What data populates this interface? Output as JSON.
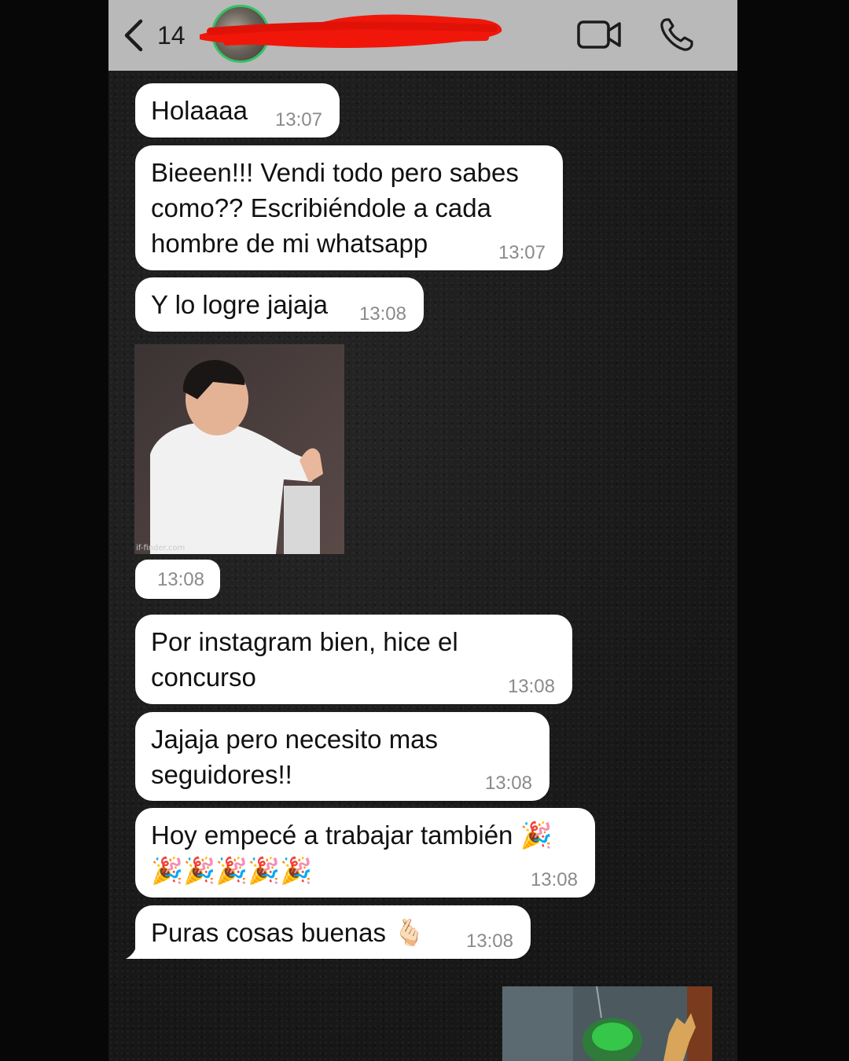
{
  "header": {
    "back_count": "14",
    "contact_name_redacted": true
  },
  "messages": [
    {
      "text": "Holaaaa",
      "time": "13:07"
    },
    {
      "text": "Bieeen!!! Vendi todo pero sabes como?? Escribiéndole a cada hombre de mi whatsapp",
      "time": "13:07"
    },
    {
      "text": "Y lo logre jajaja",
      "time": "13:08"
    },
    {
      "media": "gif",
      "caption": "if-finder.com",
      "time": "13:08"
    },
    {
      "text": "Por instagram bien, hice el concurso",
      "time": "13:08"
    },
    {
      "text": "Jajaja pero necesito mas seguidores!!",
      "time": "13:08"
    },
    {
      "text": "Hoy empecé a trabajar también 🎉🎉🎉🎉🎉🎉",
      "time": "13:08"
    },
    {
      "text": "Puras cosas buenas 🫰🏻",
      "time": "13:08"
    }
  ],
  "colors": {
    "header_bg": "#b9b9b9",
    "bubble_bg": "#ffffff",
    "timestamp": "#8a8a8a",
    "status_ring": "#36c264",
    "redaction": "#f0170a"
  },
  "icons": [
    "chevron-left-icon",
    "video-camera-icon",
    "phone-icon"
  ]
}
